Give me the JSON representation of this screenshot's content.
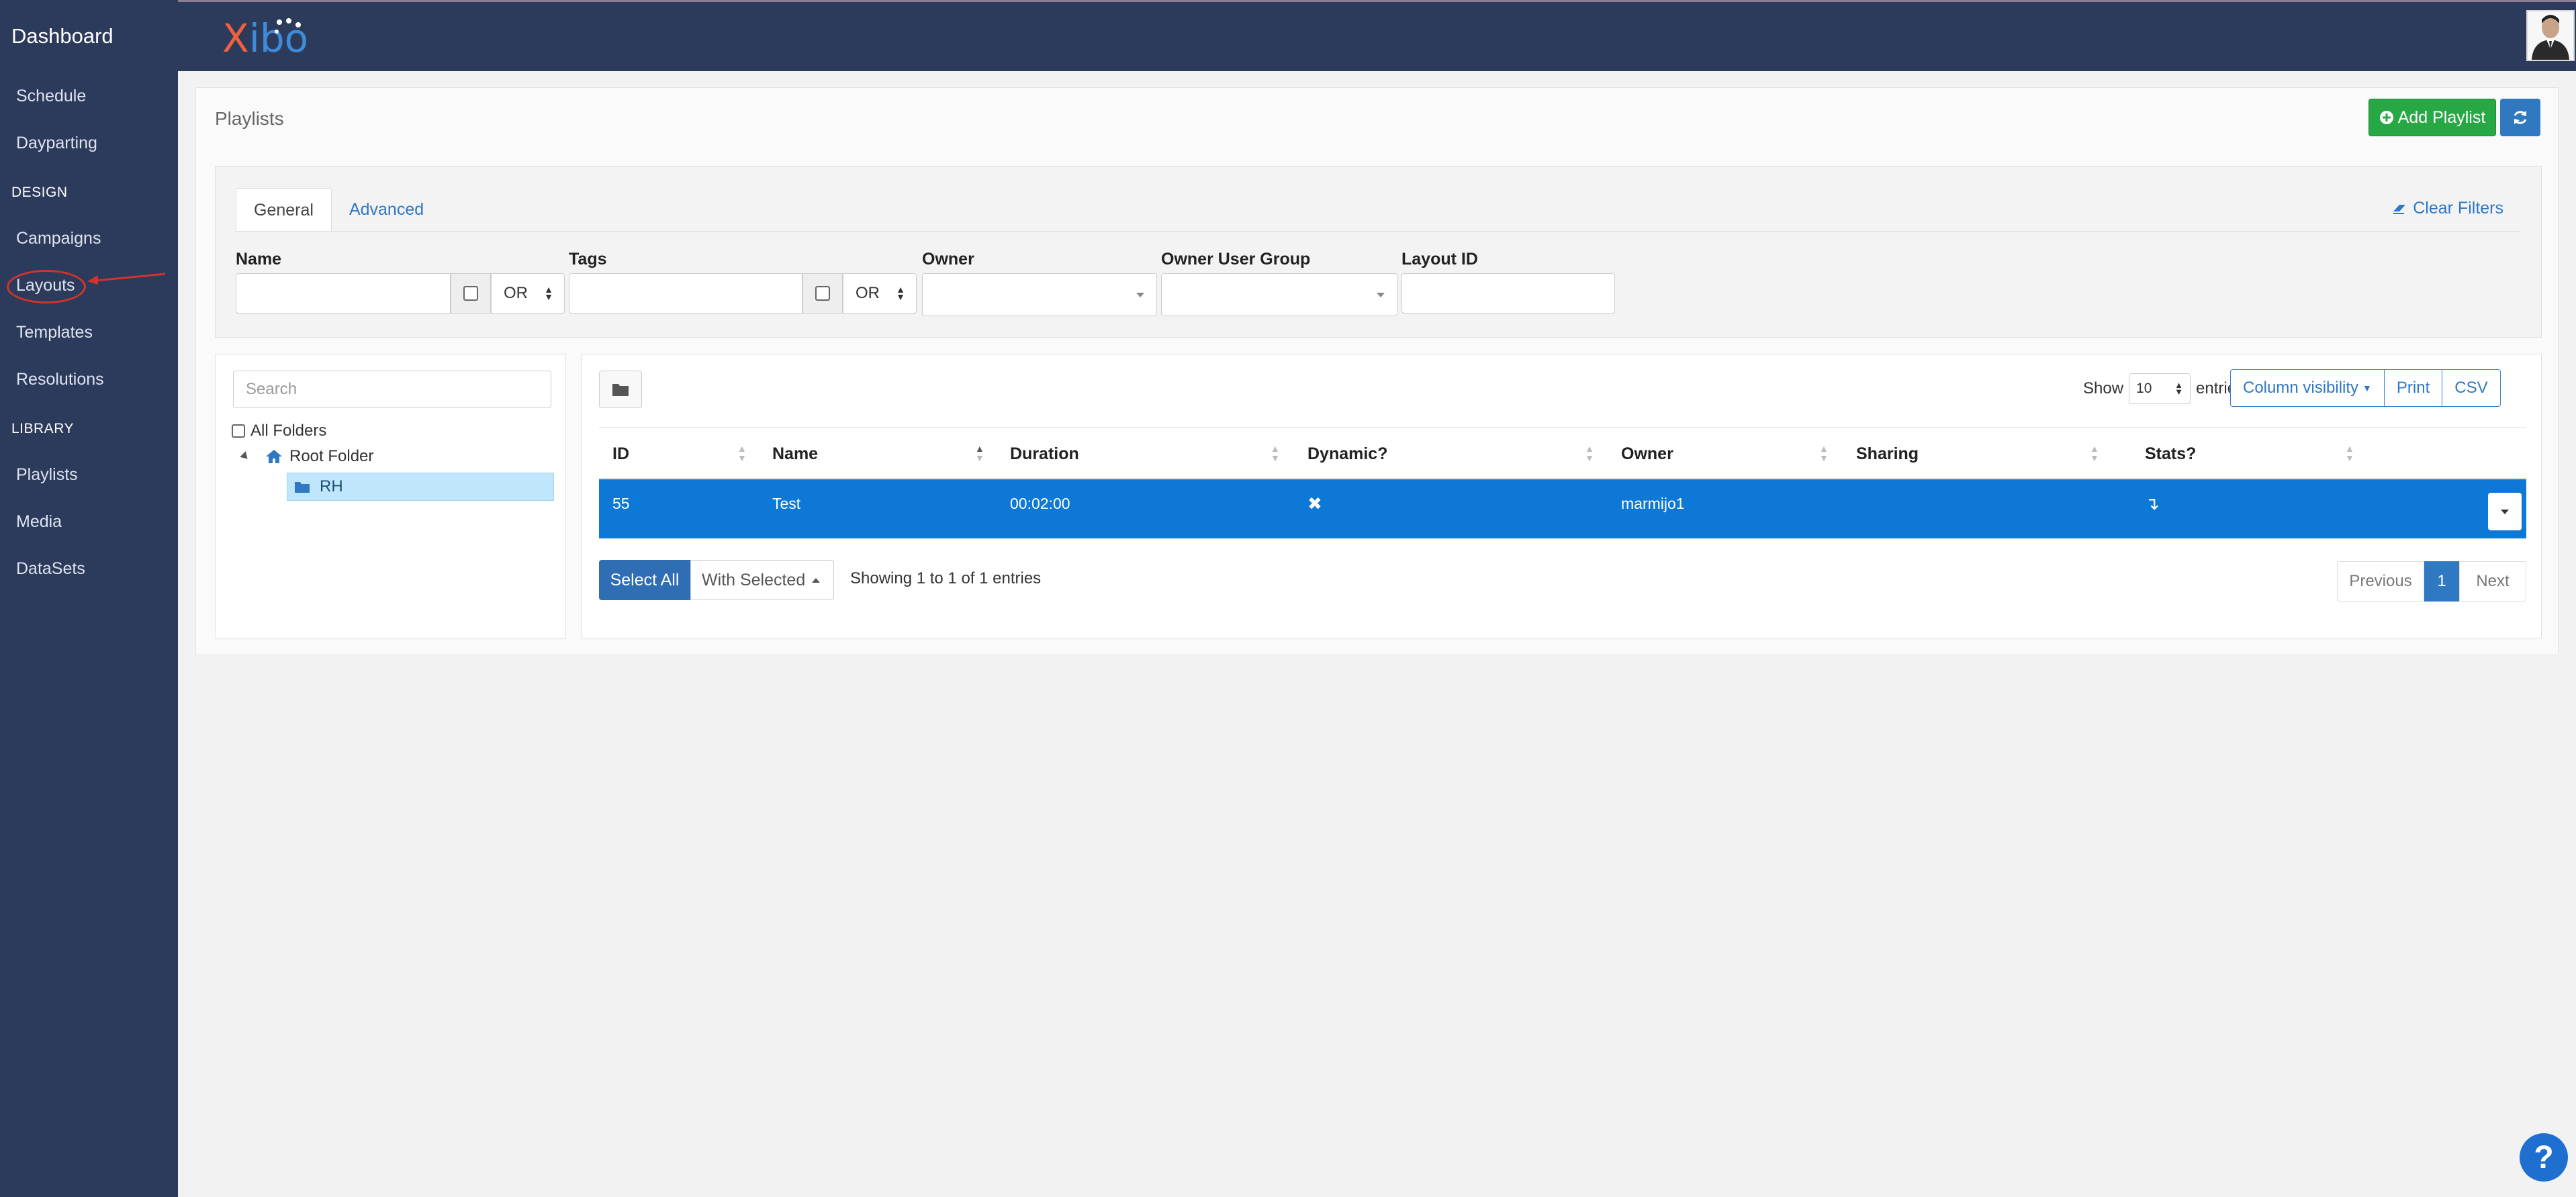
{
  "sidebar": {
    "brand": "Dashboard",
    "items_top": [
      {
        "label": "Schedule"
      },
      {
        "label": "Dayparting"
      }
    ],
    "design_section": "DESIGN",
    "design_items": [
      {
        "label": "Campaigns"
      },
      {
        "label": "Layouts"
      },
      {
        "label": "Templates"
      },
      {
        "label": "Resolutions"
      }
    ],
    "library_section": "LIBRARY",
    "library_items": [
      {
        "label": "Playlists"
      },
      {
        "label": "Media"
      },
      {
        "label": "DataSets"
      }
    ]
  },
  "header": {
    "logo_first": "X",
    "logo_rest": "ibo"
  },
  "page": {
    "title": "Playlists",
    "add_button": "Add Playlist"
  },
  "filters": {
    "tabs": [
      {
        "label": "General"
      },
      {
        "label": "Advanced"
      }
    ],
    "clear_filters": "Clear Filters",
    "name_label": "Name",
    "tags_label": "Tags",
    "owner_label": "Owner",
    "owner_group_label": "Owner User Group",
    "layout_id_label": "Layout ID",
    "or_option": "OR"
  },
  "folders": {
    "search_placeholder": "Search",
    "all_folders": "All Folders",
    "root_folder": "Root Folder",
    "selected_folder": "RH"
  },
  "table": {
    "show_label": "Show",
    "entries_label": "entries",
    "page_length": "10",
    "buttons": {
      "column_visibility": "Column visibility",
      "print": "Print",
      "csv": "CSV"
    },
    "columns": [
      "ID",
      "Name",
      "Duration",
      "Dynamic?",
      "Owner",
      "Sharing",
      "Stats?"
    ],
    "rows": [
      {
        "id": "55",
        "name": "Test",
        "duration": "00:02:00",
        "dynamic": "✖",
        "owner": "marmijo1",
        "sharing": "",
        "stats": "↴"
      }
    ],
    "select_all": "Select All",
    "with_selected": "With Selected",
    "info": "Showing 1 to 1 of 1 entries",
    "pagination": {
      "previous": "Previous",
      "current": "1",
      "next": "Next"
    }
  },
  "help": {
    "label": "?"
  },
  "colors": {
    "sidebar": "#2c3a5c",
    "selected_row": "#0e78d6",
    "add_button": "#28a745",
    "annotation": "#d0342c"
  }
}
